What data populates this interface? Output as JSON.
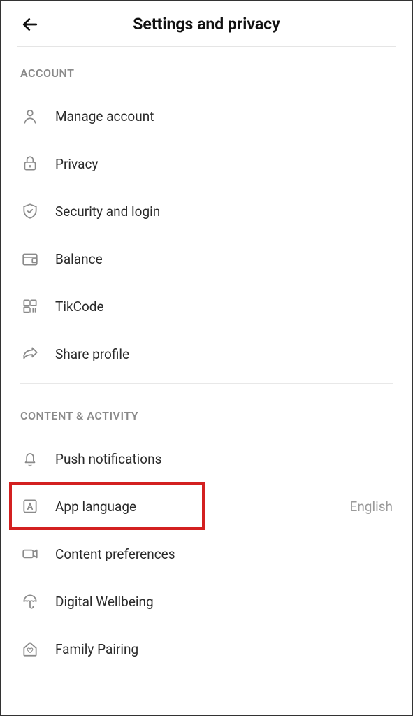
{
  "header": {
    "title": "Settings and privacy"
  },
  "sections": {
    "account": {
      "header": "ACCOUNT",
      "items": [
        {
          "label": "Manage account"
        },
        {
          "label": "Privacy"
        },
        {
          "label": "Security and login"
        },
        {
          "label": "Balance"
        },
        {
          "label": "TikCode"
        },
        {
          "label": "Share profile"
        }
      ]
    },
    "content": {
      "header": "CONTENT & ACTIVITY",
      "items": [
        {
          "label": "Push notifications"
        },
        {
          "label": "App language",
          "value": "English"
        },
        {
          "label": "Content preferences"
        },
        {
          "label": "Digital Wellbeing"
        },
        {
          "label": "Family Pairing"
        }
      ]
    }
  }
}
